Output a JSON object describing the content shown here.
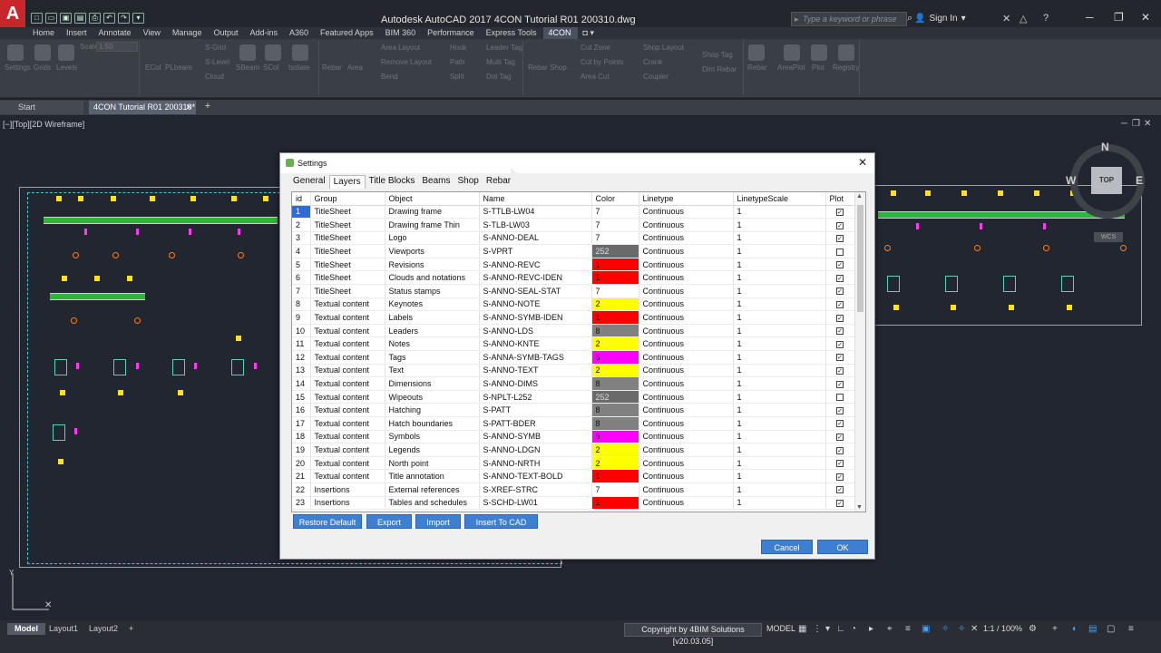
{
  "app": {
    "title": "Autodesk AutoCAD 2017    4CON Tutorial R01 200310.dwg",
    "logo": "A",
    "search_placeholder": "Type a keyword or phrase",
    "signin": "Sign In"
  },
  "ribbon_tabs": [
    "Home",
    "Insert",
    "Annotate",
    "View",
    "Manage",
    "Output",
    "Add-ins",
    "A360",
    "Featured Apps",
    "BIM 360",
    "Performance",
    "Express Tools",
    "4CON"
  ],
  "active_ribbon_tab": "4CON",
  "ribbon": {
    "settings": "Settings",
    "grids": "Grids",
    "levels": "Levels",
    "scale_label": "Scale",
    "scale_value": "1:50",
    "s_grid": "S-Grid",
    "s_level": "S-Level",
    "cloud": "Cloud",
    "ecol": "ECol",
    "plbeam": "PLbeam",
    "sbeam": "SBeam",
    "scol": "SCol",
    "isolate": "Isolate",
    "rebar": "Rebar",
    "area": "Area",
    "area_layout": "Area Layout",
    "remove_layout": "Remove Layout",
    "bend": "Bend",
    "hook": "Hook",
    "path": "Path",
    "split": "Split",
    "leader_tag": "Leader Tag",
    "multi_tag": "Multi Tag",
    "dot_tag": "Dot Tag",
    "rebar_shop": "Rebar Shop",
    "cut_zone": "Cut Zone",
    "cut_by_points": "Cut by Points",
    "area_cut": "Area Cut",
    "shop_layout": "Shop Layout",
    "crank": "Crank",
    "coupler": "Coupler",
    "shop_tag": "Shop Tag",
    "dim_rebar": "Dim Rebar",
    "rebar2": "Rebar",
    "area_plot": "AreaPlot",
    "plot": "Plot",
    "registry": "Registry"
  },
  "doc_tabs": [
    {
      "label": "Start"
    },
    {
      "label": "4CON Tutorial R01 200310*"
    }
  ],
  "viewport_label": "[−][Top][2D Wireframe]",
  "viewcube": {
    "n": "N",
    "w": "W",
    "e": "E",
    "top": "TOP",
    "wcs": "WCS"
  },
  "dialog": {
    "title": "Settings",
    "tabs": [
      "General",
      "Layers",
      "Title Blocks",
      "Beams",
      "Shop",
      "Rebar"
    ],
    "active_tab": "Layers",
    "columns": [
      "id",
      "Group",
      "Object",
      "Name",
      "Color",
      "Linetype",
      "LinetypeScale",
      "Plot"
    ],
    "rows": [
      {
        "id": "1",
        "group": "TitleSheet",
        "object": "Drawing frame",
        "name": "S-TTLB-LW04",
        "color": "7",
        "color_hex": "#ffffff",
        "linetype": "Continuous",
        "scale": "1",
        "plot": true
      },
      {
        "id": "2",
        "group": "TitleSheet",
        "object": "Drawing frame Thin",
        "name": "S-TLB-LW03",
        "color": "7",
        "color_hex": "#ffffff",
        "linetype": "Continuous",
        "scale": "1",
        "plot": true
      },
      {
        "id": "3",
        "group": "TitleSheet",
        "object": "Logo",
        "name": "S-ANNO-DEAL",
        "color": "7",
        "color_hex": "#ffffff",
        "linetype": "Continuous",
        "scale": "1",
        "plot": true
      },
      {
        "id": "4",
        "group": "TitleSheet",
        "object": "Viewports",
        "name": "S-VPRT",
        "color": "252",
        "color_hex": "#6a6a6a",
        "linetype": "Continuous",
        "scale": "1",
        "plot": false
      },
      {
        "id": "5",
        "group": "TitleSheet",
        "object": "Revisions",
        "name": "S-ANNO-REVC",
        "color": "1",
        "color_hex": "#ff0000",
        "linetype": "Continuous",
        "scale": "1",
        "plot": true
      },
      {
        "id": "6",
        "group": "TitleSheet",
        "object": "Clouds and notations",
        "name": "S-ANNO-REVC-IDEN",
        "color": "1",
        "color_hex": "#ff0000",
        "linetype": "Continuous",
        "scale": "1",
        "plot": true
      },
      {
        "id": "7",
        "group": "TitleSheet",
        "object": "Status stamps",
        "name": "S-ANNO-SEAL-STAT",
        "color": "7",
        "color_hex": "#ffffff",
        "linetype": "Continuous",
        "scale": "1",
        "plot": true
      },
      {
        "id": "8",
        "group": "Textual content",
        "object": "Keynotes",
        "name": "S-ANNO-NOTE",
        "color": "2",
        "color_hex": "#ffff00",
        "linetype": "Continuous",
        "scale": "1",
        "plot": true
      },
      {
        "id": "9",
        "group": "Textual content",
        "object": "Labels",
        "name": "S-ANNO-SYMB-IDEN",
        "color": "1",
        "color_hex": "#ff0000",
        "linetype": "Continuous",
        "scale": "1",
        "plot": true
      },
      {
        "id": "10",
        "group": "Textual content",
        "object": "Leaders",
        "name": "S-ANNO-LDS",
        "color": "8",
        "color_hex": "#808080",
        "linetype": "Continuous",
        "scale": "1",
        "plot": true
      },
      {
        "id": "11",
        "group": "Textual content",
        "object": "Notes",
        "name": "S-ANNO-KNTE",
        "color": "2",
        "color_hex": "#ffff00",
        "linetype": "Continuous",
        "scale": "1",
        "plot": true
      },
      {
        "id": "12",
        "group": "Textual content",
        "object": "Tags",
        "name": "S-ANNA-SYMB-TAGS",
        "color": "6",
        "color_hex": "#ff00ff",
        "linetype": "Continuous",
        "scale": "1",
        "plot": true
      },
      {
        "id": "13",
        "group": "Textual content",
        "object": "Text",
        "name": "S-ANNO-TEXT",
        "color": "2",
        "color_hex": "#ffff00",
        "linetype": "Continuous",
        "scale": "1",
        "plot": true
      },
      {
        "id": "14",
        "group": "Textual content",
        "object": "Dimensions",
        "name": "S-ANNO-DIMS",
        "color": "8",
        "color_hex": "#808080",
        "linetype": "Continuous",
        "scale": "1",
        "plot": true
      },
      {
        "id": "15",
        "group": "Textual content",
        "object": "Wipeouts",
        "name": "S-NPLT-L252",
        "color": "252",
        "color_hex": "#6a6a6a",
        "linetype": "Continuous",
        "scale": "1",
        "plot": false
      },
      {
        "id": "16",
        "group": "Textual content",
        "object": "Hatching",
        "name": "S-PATT",
        "color": "8",
        "color_hex": "#808080",
        "linetype": "Continuous",
        "scale": "1",
        "plot": true
      },
      {
        "id": "17",
        "group": "Textual content",
        "object": "Hatch boundaries",
        "name": "S-PATT-BDER",
        "color": "8",
        "color_hex": "#808080",
        "linetype": "Continuous",
        "scale": "1",
        "plot": true
      },
      {
        "id": "18",
        "group": "Textual content",
        "object": "Symbols",
        "name": "S-ANNO-SYMB",
        "color": "6",
        "color_hex": "#ff00ff",
        "linetype": "Continuous",
        "scale": "1",
        "plot": true
      },
      {
        "id": "19",
        "group": "Textual content",
        "object": "Legends",
        "name": "S-ANNO-LDGN",
        "color": "2",
        "color_hex": "#ffff00",
        "linetype": "Continuous",
        "scale": "1",
        "plot": true
      },
      {
        "id": "20",
        "group": "Textual content",
        "object": "North point",
        "name": "S-ANNO-NRTH",
        "color": "2",
        "color_hex": "#ffff00",
        "linetype": "Continuous",
        "scale": "1",
        "plot": true
      },
      {
        "id": "21",
        "group": "Textual content",
        "object": "Title annotation",
        "name": "S-ANNO-TEXT-BOLD",
        "color": "1",
        "color_hex": "#ff0000",
        "linetype": "Continuous",
        "scale": "1",
        "plot": true
      },
      {
        "id": "22",
        "group": "Insertions",
        "object": "External references",
        "name": "S-XREF-STRC",
        "color": "7",
        "color_hex": "#ffffff",
        "linetype": "Continuous",
        "scale": "1",
        "plot": true
      },
      {
        "id": "23",
        "group": "Insertions",
        "object": "Tables and schedules",
        "name": "S-SCHD-LW01",
        "color": "1",
        "color_hex": "#ff0000",
        "linetype": "Continuous",
        "scale": "1",
        "plot": true
      }
    ],
    "buttons": {
      "restore_default": "Restore Default",
      "export": "Export",
      "import": "Import",
      "insert_to_cad": "Insert To CAD",
      "cancel": "Cancel",
      "ok": "OK"
    }
  },
  "statusbar": {
    "tabs": [
      "Model",
      "Layout1",
      "Layout2"
    ],
    "active_tab": "Model",
    "copyright": "Copyright by 4BIM Solutions [v20.03.05]",
    "model": "MODEL",
    "zoom": "1:1 / 100%"
  },
  "colors": {
    "title_bg": "#23262c",
    "ribbon_bg": "#3a3e45",
    "canvas_bg": "#222630",
    "accent_blue": "#3d7fd1",
    "selected_row": "#2f6bd6",
    "autocad_red": "#c9262b"
  }
}
